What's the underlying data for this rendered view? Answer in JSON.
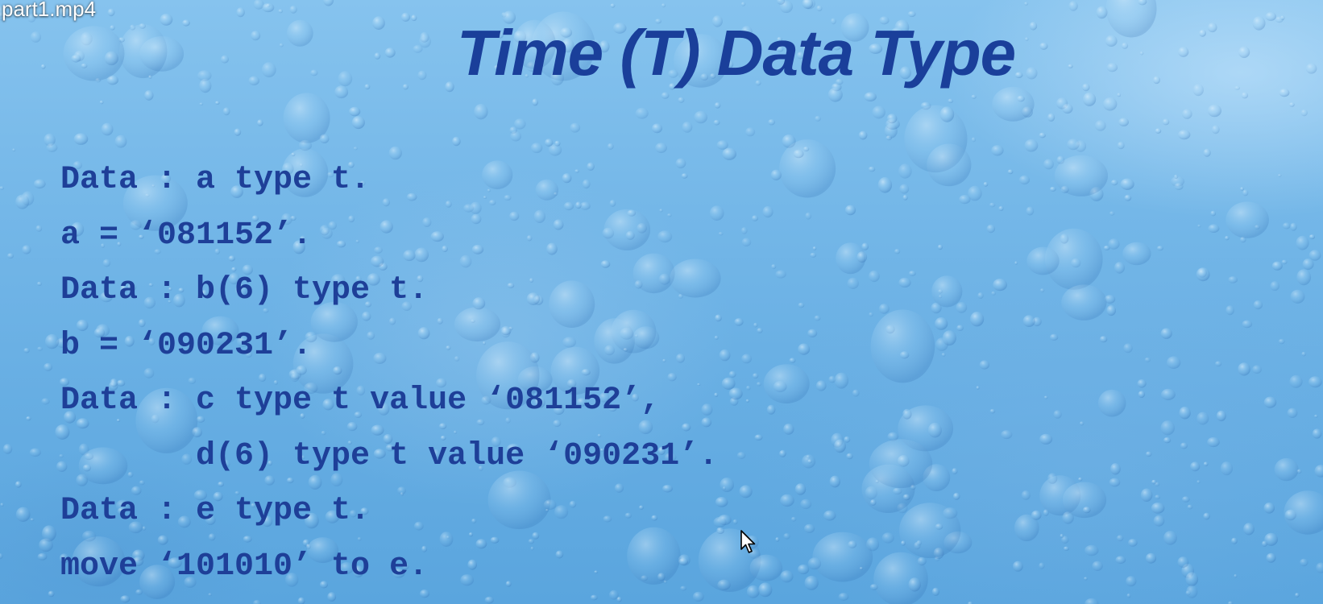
{
  "video": {
    "filename": "part1.mp4"
  },
  "slide": {
    "title": "Time (T) Data Type",
    "code_lines": [
      "Data : a type t.",
      "a = ‘081152’.",
      "Data : b(6) type t.",
      "b = ‘090231’.",
      "Data : c type t value ‘081152’,",
      "       d(6) type t value ‘090231’.",
      "Data : e type t.",
      "move ‘101010’ to e."
    ]
  },
  "colors": {
    "title_text": "#1a3f9a",
    "code_text": "#1e3f98",
    "background": "#74b7e8"
  },
  "icons": {
    "cursor": "mouse-pointer-icon"
  }
}
